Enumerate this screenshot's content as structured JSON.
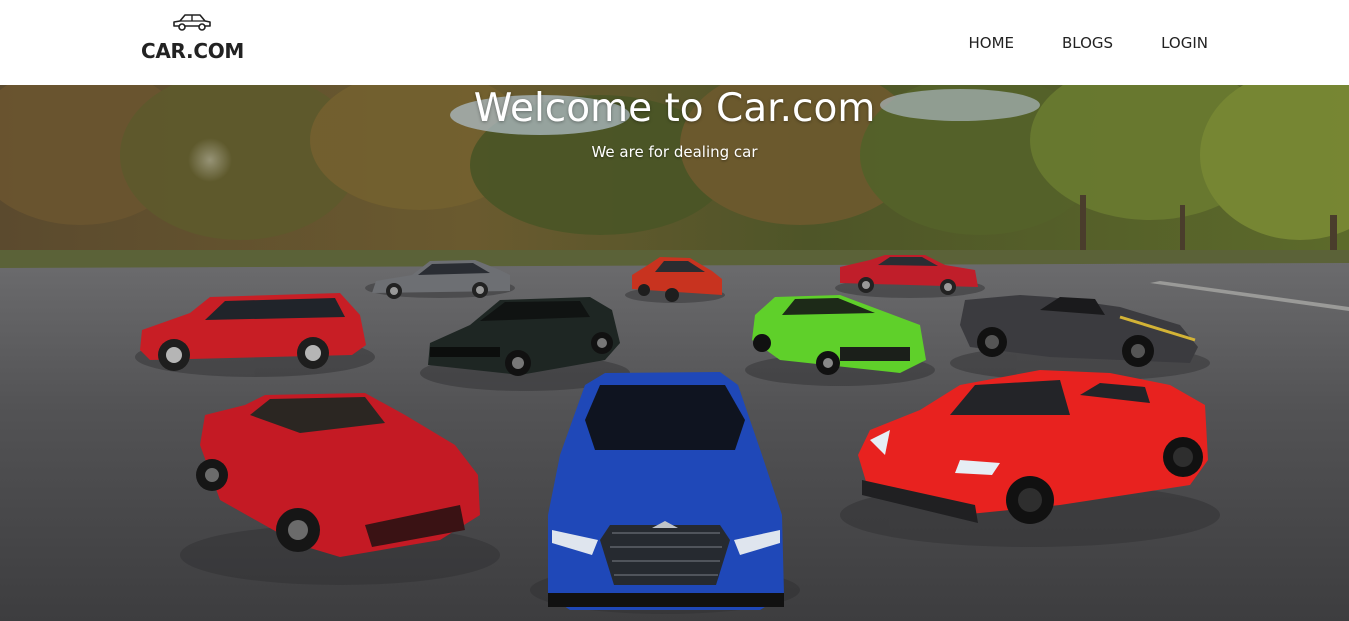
{
  "brand": {
    "name": "CAR.COM",
    "icon": "car-icon"
  },
  "nav": {
    "items": [
      {
        "label": "HOME"
      },
      {
        "label": "BLOGS"
      },
      {
        "label": "LOGIN"
      }
    ]
  },
  "hero": {
    "title": "Welcome to Car.com",
    "subtitle": "We are for dealing car"
  },
  "colors": {
    "header_bg": "#ffffff",
    "text_dark": "#222222",
    "hero_text": "#ffffff",
    "asphalt": "#4a4a4c",
    "foliage": "#4f5a2a"
  },
  "cars": [
    {
      "color": "#c81e25",
      "kind": "hatchback"
    },
    {
      "color": "#6d6f73",
      "kind": "sedan"
    },
    {
      "color": "#1e2623",
      "kind": "muscle"
    },
    {
      "color": "#c8331f",
      "kind": "coupe"
    },
    {
      "color": "#c01e2a",
      "kind": "sedan"
    },
    {
      "color": "#5fd02a",
      "kind": "coupe"
    },
    {
      "color": "#3b3b3f",
      "kind": "convertible"
    },
    {
      "color": "#c41a24",
      "kind": "roadster"
    },
    {
      "color": "#1f48b8",
      "kind": "sedan-front"
    },
    {
      "color": "#e8221f",
      "kind": "sports"
    }
  ]
}
